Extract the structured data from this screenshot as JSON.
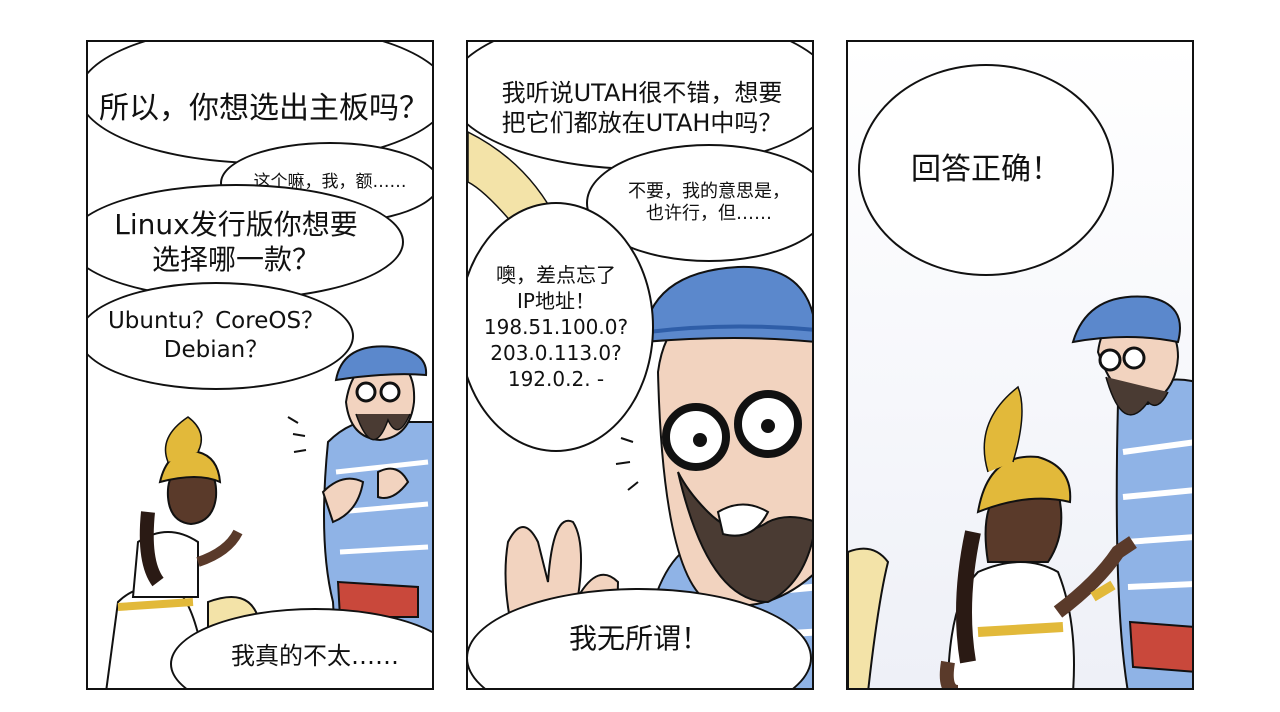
{
  "panels": [
    {
      "bubbles": {
        "b1": "所以，你想选出主板吗？",
        "b2": "这个嘛，我，额……",
        "b3": "Linux发行版你想要\n选择哪一款？",
        "b4": "Ubuntu？CoreOS？\nDebian？",
        "b5": "我真的不太……"
      }
    },
    {
      "bubbles": {
        "b1": "我听说UTAH很不错，想要\n把它们都放在UTAH中吗？",
        "b2": "不要，我的意思是，\n也许行，但……",
        "b3": "噢，差点忘了\nIP地址！\n198.51.100.0?\n203.0.113.0?\n192.0.2. -",
        "b4": "我无所谓！"
      }
    },
    {
      "bubbles": {
        "b1": "回答正确！"
      }
    }
  ],
  "colors": {
    "sweater": "#8fb3e6",
    "cap": "#5b88cc",
    "skin_girl": "#5a3a2a",
    "skin_man": "#f2d3bf",
    "gold": "#e2b93a",
    "plaid": "#c9483b",
    "paper": "#f3e3a8"
  }
}
